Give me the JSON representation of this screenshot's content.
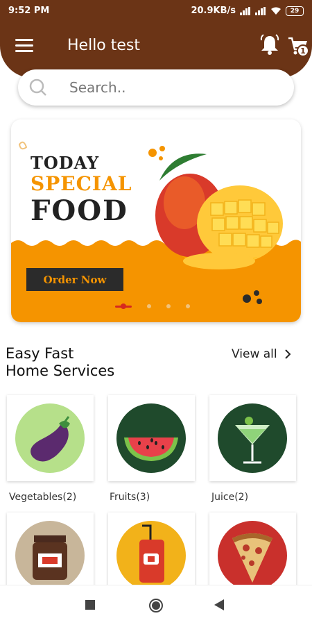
{
  "status": {
    "time": "9:52 PM",
    "speed": "20.9KB/s",
    "battery": "29"
  },
  "header": {
    "title": "Hello test",
    "cart_count": "1"
  },
  "search": {
    "placeholder": "Search.."
  },
  "banner": {
    "line1": "TODAY",
    "line2": "SPECIAL",
    "line3": "FOOD",
    "button": "Order Now",
    "slides": 4,
    "active_slide": 1
  },
  "section": {
    "title_line1": "Easy Fast",
    "title_line2": "Home Services",
    "view_all": "View all"
  },
  "categories": [
    {
      "label": "Vegetables(2)",
      "icon": "eggplant-icon"
    },
    {
      "label": "Fruits(3)",
      "icon": "watermelon-icon"
    },
    {
      "label": "Juice(2)",
      "icon": "cocktail-icon"
    },
    {
      "label": "",
      "icon": "jar-icon"
    },
    {
      "label": "",
      "icon": "soda-can-icon"
    },
    {
      "label": "",
      "icon": "pizza-icon"
    }
  ],
  "colors": {
    "primary": "#6b3416",
    "accent": "#f59400",
    "dark": "#2b2b2b"
  }
}
